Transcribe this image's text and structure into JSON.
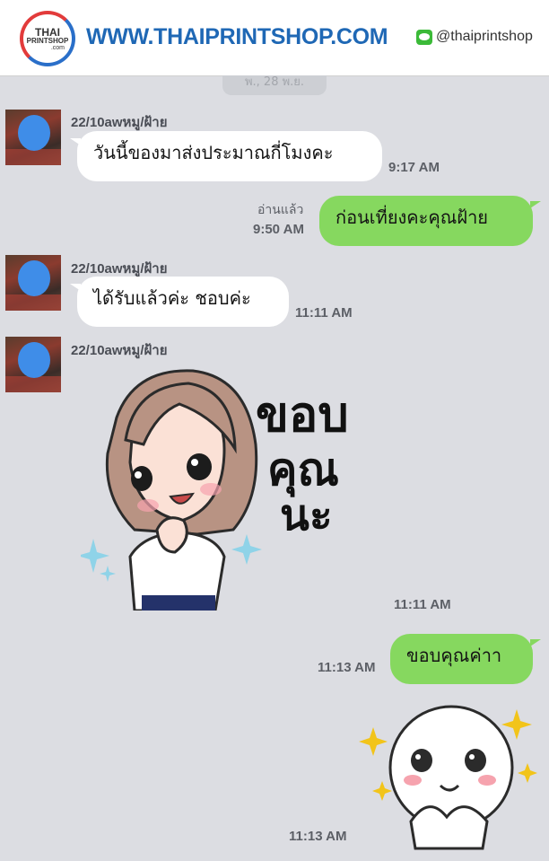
{
  "header": {
    "logo_top": "THAI",
    "logo_mid": "PRINTSHOP",
    "logo_bottom": ".com",
    "site_url": "WWW.THAIPRINTSHOP.COM",
    "line_handle": "@thaiprintshop",
    "line_icon": "line-app-icon"
  },
  "chat": {
    "date_separator": "พ., 28 พ.ย.",
    "contact_name": "22/10awหมู/ฝ้าย",
    "messages": [
      {
        "from": "contact",
        "type": "text",
        "text": "วันนี้ของมาส่งประมาณกี่โมงคะ",
        "time": "9:17 AM"
      },
      {
        "from": "me",
        "type": "text",
        "text": "ก่อนเที่ยงคะคุณฝ้าย",
        "time": "9:50 AM",
        "status": "อ่านแล้ว"
      },
      {
        "from": "contact",
        "type": "text",
        "text": "ได้รับแล้วค่ะ ชอบค่ะ",
        "time": "11:11 AM"
      },
      {
        "from": "contact",
        "type": "sticker",
        "sticker_text": "ขอบคุณนะ",
        "sticker_lines": [
          "ขอบ",
          "คุณ",
          "นะ"
        ],
        "time": "11:11 AM"
      },
      {
        "from": "me",
        "type": "text",
        "text": "ขอบคุณค่าา",
        "time": "11:13 AM"
      },
      {
        "from": "me",
        "type": "sticker",
        "sticker_text": "",
        "time": "11:13 AM"
      }
    ]
  },
  "colors": {
    "background": "#dcdde2",
    "outgoing_bubble": "#86d85f",
    "incoming_bubble": "#ffffff",
    "url_blue": "#1f68b5",
    "line_green": "#3bba38"
  }
}
